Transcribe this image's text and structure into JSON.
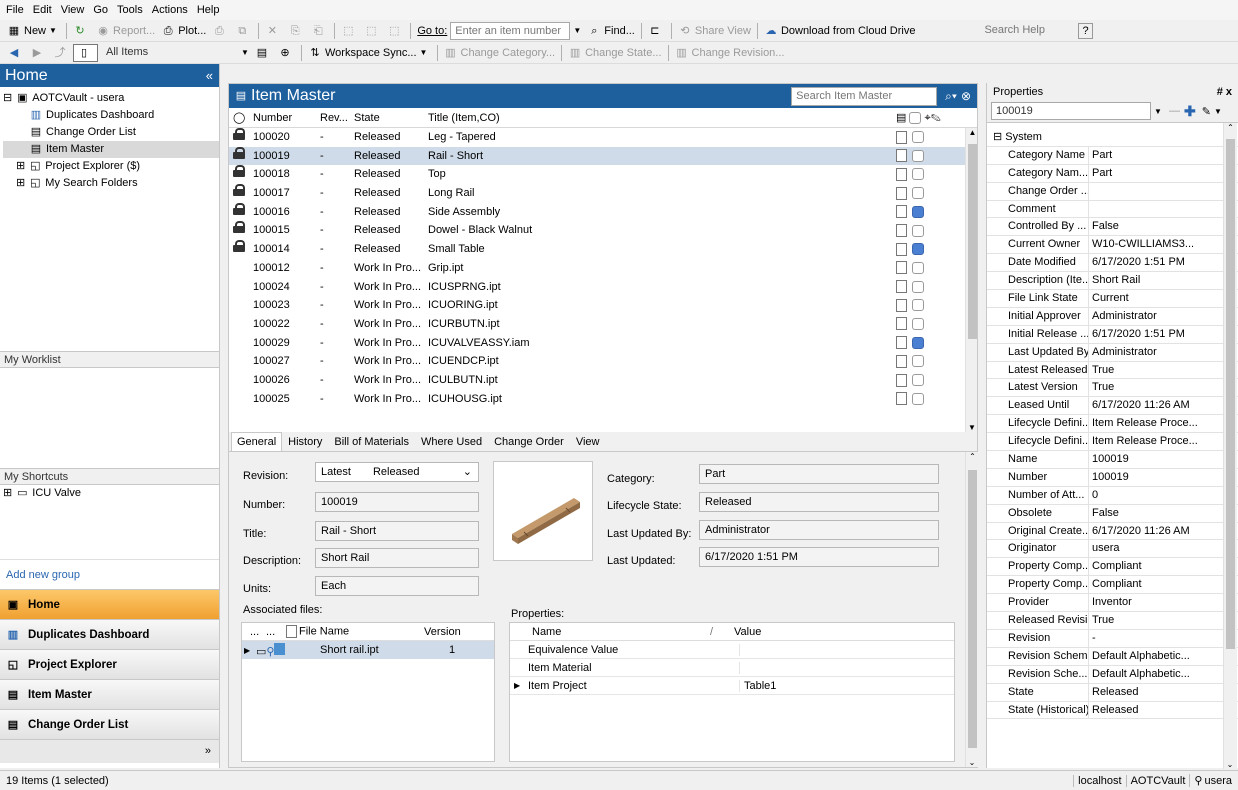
{
  "menu": [
    "File",
    "Edit",
    "View",
    "Go",
    "Tools",
    "Actions",
    "Help"
  ],
  "toolbar1": {
    "new": "New",
    "report": "Report...",
    "plot": "Plot...",
    "goto_label": "Go to:",
    "goto_placeholder": "Enter an item number",
    "find": "Find...",
    "share_view": "Share View",
    "download": "Download from Cloud Drive",
    "search_help": "Search Help"
  },
  "toolbar2": {
    "scope": "All Items",
    "workspace_sync": "Workspace Sync...",
    "change_category": "Change Category...",
    "change_state": "Change State...",
    "change_revision": "Change Revision..."
  },
  "left": {
    "title": "Home",
    "tree": {
      "root": "AOTCVault - usera",
      "items": [
        "Duplicates Dashboard",
        "Change Order List",
        "Item Master"
      ],
      "expandable": [
        "Project Explorer ($)",
        "My Search Folders"
      ]
    },
    "worklist": "My Worklist",
    "shortcuts": "My Shortcuts",
    "shortcut_items": [
      "ICU Valve"
    ],
    "add_group": "Add new group",
    "nav": [
      "Home",
      "Duplicates Dashboard",
      "Project Explorer",
      "Item Master",
      "Change Order List"
    ]
  },
  "center": {
    "title": "Item Master",
    "search_placeholder": "Search Item Master",
    "columns": [
      "Number",
      "Rev...",
      "State",
      "Title (Item,CO)"
    ],
    "rows": [
      {
        "number": "100020",
        "rev": "-",
        "state": "Released",
        "title": "Leg - Tapered",
        "locked": true,
        "flag": false
      },
      {
        "number": "100019",
        "rev": "-",
        "state": "Released",
        "title": "Rail - Short",
        "locked": true,
        "flag": false
      },
      {
        "number": "100018",
        "rev": "-",
        "state": "Released",
        "title": "Top",
        "locked": true,
        "flag": false
      },
      {
        "number": "100017",
        "rev": "-",
        "state": "Released",
        "title": "Long Rail",
        "locked": true,
        "flag": false
      },
      {
        "number": "100016",
        "rev": "-",
        "state": "Released",
        "title": "Side Assembly",
        "locked": true,
        "flag": true
      },
      {
        "number": "100015",
        "rev": "-",
        "state": "Released",
        "title": "Dowel - Black Walnut",
        "locked": true,
        "flag": false
      },
      {
        "number": "100014",
        "rev": "-",
        "state": "Released",
        "title": "Small Table",
        "locked": true,
        "flag": true
      },
      {
        "number": "100012",
        "rev": "-",
        "state": "Work In Pro...",
        "title": "Grip.ipt",
        "locked": false,
        "flag": false
      },
      {
        "number": "100024",
        "rev": "-",
        "state": "Work In Pro...",
        "title": "ICUSPRNG.ipt",
        "locked": false,
        "flag": false
      },
      {
        "number": "100023",
        "rev": "-",
        "state": "Work In Pro...",
        "title": "ICUORING.ipt",
        "locked": false,
        "flag": false
      },
      {
        "number": "100022",
        "rev": "-",
        "state": "Work In Pro...",
        "title": "ICURBUTN.ipt",
        "locked": false,
        "flag": false
      },
      {
        "number": "100029",
        "rev": "-",
        "state": "Work In Pro...",
        "title": "ICUVALVEASSY.iam",
        "locked": false,
        "flag": true
      },
      {
        "number": "100027",
        "rev": "-",
        "state": "Work In Pro...",
        "title": "ICUENDCP.ipt",
        "locked": false,
        "flag": false
      },
      {
        "number": "100026",
        "rev": "-",
        "state": "Work In Pro...",
        "title": "ICULBUTN.ipt",
        "locked": false,
        "flag": false
      },
      {
        "number": "100025",
        "rev": "-",
        "state": "Work In Pro...",
        "title": "ICUHOUSG.ipt",
        "locked": false,
        "flag": false
      }
    ],
    "selected_index": 1,
    "tabs": [
      "General",
      "History",
      "Bill of Materials",
      "Where Used",
      "Change Order",
      "View"
    ],
    "general": {
      "revision_label": "Revision:",
      "revision_value": "Latest",
      "revision_state": "Released",
      "number_label": "Number:",
      "number_value": "100019",
      "title_label": "Title:",
      "title_value": "Rail - Short",
      "description_label": "Description:",
      "description_value": "Short Rail",
      "units_label": "Units:",
      "units_value": "Each",
      "category_label": "Category:",
      "category_value": "Part",
      "lifecycle_label": "Lifecycle State:",
      "lifecycle_value": "Released",
      "updated_by_label": "Last Updated By:",
      "updated_by_value": "Administrator",
      "updated_label": "Last Updated:",
      "updated_value": "6/17/2020 1:51 PM",
      "assoc_label": "Associated files:",
      "assoc_cols": [
        "...",
        "...",
        "File Name",
        "Version"
      ],
      "assoc_file": "Short rail.ipt",
      "assoc_version": "1",
      "props_label": "Properties:",
      "props_cols": [
        "Name",
        "/",
        "Value"
      ],
      "props_rows": [
        {
          "name": "Equivalence Value",
          "value": ""
        },
        {
          "name": "Item Material",
          "value": ""
        },
        {
          "name": "Item Project",
          "value": "Table1"
        }
      ]
    }
  },
  "right": {
    "title": "Properties",
    "pin": "# x",
    "selector": "100019",
    "group": "System",
    "rows": [
      [
        "Category Name",
        "Part"
      ],
      [
        "Category Nam...",
        "Part"
      ],
      [
        "Change Order ...",
        ""
      ],
      [
        "Comment",
        ""
      ],
      [
        "Controlled By ...",
        "False"
      ],
      [
        "Current Owner",
        "W10-CWILLIAMS3..."
      ],
      [
        "Date Modified",
        "6/17/2020 1:51 PM"
      ],
      [
        "Description (Ite...",
        "Short Rail"
      ],
      [
        "File Link State",
        "Current"
      ],
      [
        "Initial Approver",
        "Administrator"
      ],
      [
        "Initial Release ...",
        "6/17/2020 1:51 PM"
      ],
      [
        "Last Updated By",
        "Administrator"
      ],
      [
        "Latest Released...",
        "True"
      ],
      [
        "Latest Version",
        "True"
      ],
      [
        "Leased Until",
        "6/17/2020 11:26 AM"
      ],
      [
        "Lifecycle Defini...",
        "Item Release Proce..."
      ],
      [
        "Lifecycle Defini...",
        "Item Release Proce..."
      ],
      [
        "Name",
        "100019"
      ],
      [
        "Number",
        "100019"
      ],
      [
        "Number of Att...",
        "0"
      ],
      [
        "Obsolete",
        "False"
      ],
      [
        "Original Create...",
        "6/17/2020 11:26 AM"
      ],
      [
        "Originator",
        "usera"
      ],
      [
        "Property Comp...",
        "Compliant"
      ],
      [
        "Property Comp...",
        "Compliant"
      ],
      [
        "Provider",
        "Inventor"
      ],
      [
        "Released Revisi...",
        "True"
      ],
      [
        "Revision",
        "-"
      ],
      [
        "Revision Scheme",
        "Default Alphabetic..."
      ],
      [
        "Revision Sche...",
        "Default Alphabetic..."
      ],
      [
        "State",
        "Released"
      ],
      [
        "State (Historical)",
        "Released"
      ]
    ]
  },
  "status": {
    "left": "19 Items (1 selected)",
    "server": "localhost",
    "vault": "AOTCVault",
    "user": "usera"
  },
  "colors": {
    "header_blue": "#1e5f9e",
    "nav_active": "#f0a030",
    "selection": "#cfdbe8"
  }
}
